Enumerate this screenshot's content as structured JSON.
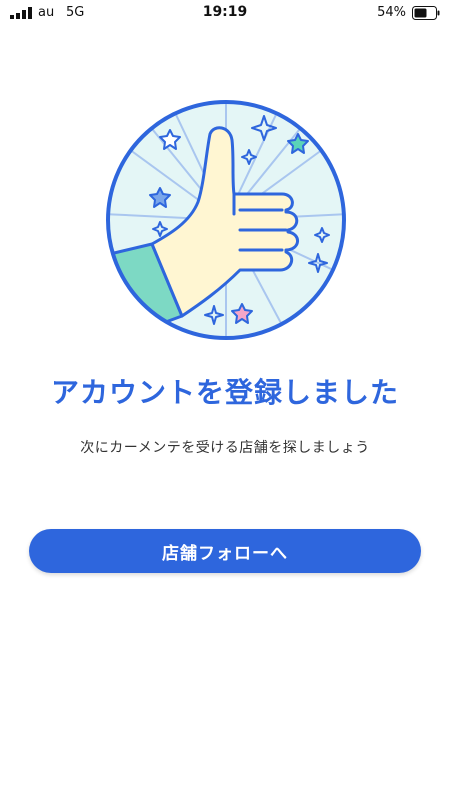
{
  "status_bar": {
    "carrier": "au",
    "network": "5G",
    "time": "19:19",
    "battery_percent": "54%"
  },
  "illustration": {
    "icon": "thumbs-up-icon",
    "colors": {
      "circle_border": "#2e66dd",
      "circle_fill": "#e4f6f6",
      "hand_fill": "#fff6d2",
      "sleeve_fill": "#7dd9c4"
    }
  },
  "main": {
    "heading": "アカウントを登録しました",
    "subtext": "次にカーメンテを受ける店舗を探しましょう",
    "primary_button_label": "店舗フォローへ"
  },
  "colors": {
    "accent": "#2e66dd"
  }
}
